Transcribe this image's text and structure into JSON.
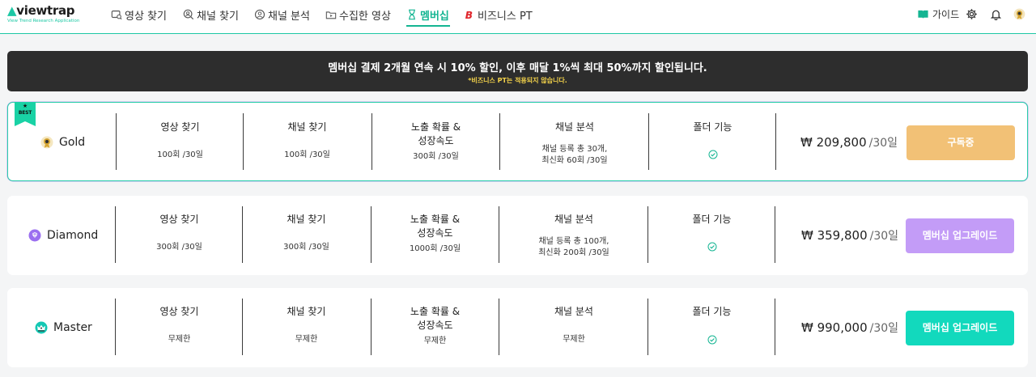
{
  "brand": {
    "logo_text": "viewtrap",
    "logo_tagline": "View Trend Research Application",
    "color_primary": "#14b592"
  },
  "nav": {
    "items": [
      {
        "label": "영상 찾기",
        "icon": "video-search-icon"
      },
      {
        "label": "채널 찾기",
        "icon": "channel-search-icon"
      },
      {
        "label": "채널 분석",
        "icon": "channel-analysis-icon"
      },
      {
        "label": "수집한 영상",
        "icon": "collected-videos-icon"
      },
      {
        "label": "멤버십",
        "icon": "membership-hourglass-icon",
        "active": true
      },
      {
        "label": "비즈니스 PT",
        "icon": "business-b-icon"
      }
    ]
  },
  "header_utils": {
    "guide_label": "가이드",
    "settings_icon": "gear-icon",
    "notifications_icon": "bell-icon",
    "avatar_icon": "gold-tier-avatar"
  },
  "notice": {
    "main": "멤버십 결제 2개월 연속 시 10% 할인, 이후 매달 1%씩 최대 50%까지 할인됩니다.",
    "sub": "*비즈니스 PT는 적용되지 않습니다."
  },
  "plans": [
    {
      "name": "Gold",
      "best": true,
      "badge": "BEST",
      "icon": "gold-tier-icon",
      "icon_color": "#d6a531",
      "features": {
        "video_search": {
          "title": "영상 찾기",
          "value": "100회 /30일"
        },
        "channel_search": {
          "title": "채널 찾기",
          "value": "100회 /30일"
        },
        "exposure": {
          "title_1": "노출 확률 &",
          "title_2": "성장속도",
          "value": "300회 /30일"
        },
        "channel_analysis": {
          "title": "채널 분석",
          "value_1": "채널 등록 총 30개,",
          "value_2": "최신화 60회 /30일"
        },
        "folder": {
          "title": "폴더 기능",
          "enabled": true
        }
      },
      "price": "₩ 209,800",
      "period": "/30일",
      "button_label": "구독중",
      "button_color": "#f2c176"
    },
    {
      "name": "Diamond",
      "best": false,
      "icon": "diamond-tier-icon",
      "icon_color": "#9b6ff0",
      "features": {
        "video_search": {
          "title": "영상 찾기",
          "value": "300회 /30일"
        },
        "channel_search": {
          "title": "채널 찾기",
          "value": "300회 /30일"
        },
        "exposure": {
          "title_1": "노출 확률 &",
          "title_2": "성장속도",
          "value": "1000회 /30일"
        },
        "channel_analysis": {
          "title": "채널 분석",
          "value_1": "채널 등록 총 100개,",
          "value_2": "최신화 200회 /30일"
        },
        "folder": {
          "title": "폴더 기능",
          "enabled": true
        }
      },
      "price": "₩ 359,800",
      "period": "/30일",
      "button_label": "멤버십 업그레이드",
      "button_color": "#c39cf7"
    },
    {
      "name": "Master",
      "best": false,
      "icon": "master-tier-icon",
      "icon_color": "#14c8b4",
      "features": {
        "video_search": {
          "title": "영상 찾기",
          "value": "무제한"
        },
        "channel_search": {
          "title": "채널 찾기",
          "value": "무제한"
        },
        "exposure": {
          "title_1": "노출 확률 &",
          "title_2": "성장속도",
          "value": "무제한"
        },
        "channel_analysis": {
          "title": "채널 분석",
          "value": "무제한"
        },
        "folder": {
          "title": "폴더 기능",
          "enabled": true
        }
      },
      "price": "₩ 990,000",
      "period": "/30일",
      "button_label": "멤버십 업그레이드",
      "button_color": "#12d9bd"
    }
  ]
}
